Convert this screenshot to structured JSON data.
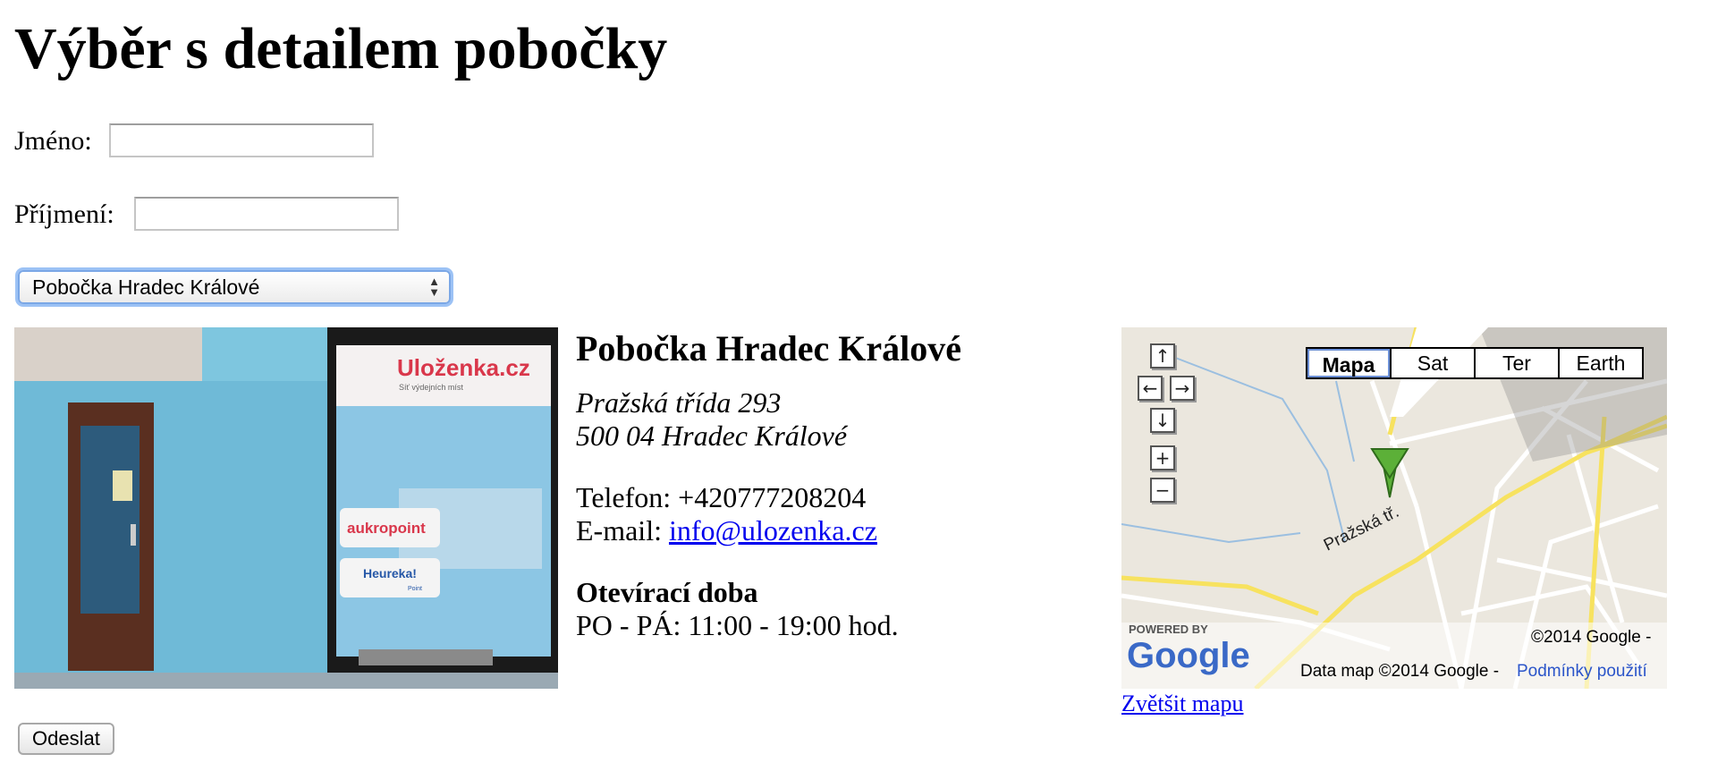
{
  "page": {
    "title": "Výběr s detailem pobočky"
  },
  "form": {
    "first_name_label": "Jméno:",
    "first_name_value": "",
    "last_name_label": "Příjmení:",
    "last_name_value": "",
    "branch_selected": "Pobočka Hradec Králové",
    "submit_label": "Odeslat"
  },
  "branch": {
    "name": "Pobočka Hradec Králové",
    "address_line1": "Pražská třída 293",
    "address_line2": "500 04 Hradec Králové",
    "phone_label": "Telefon:",
    "phone": "+420777208204",
    "email_label": "E-mail:",
    "email": "info@ulozenka.cz",
    "hours_heading": "Otevírací doba",
    "hours": "PO - PÁ: 11:00 - 19:00 hod.",
    "photo_signs": {
      "ulozenka": "Uloženka.cz",
      "ulozenka_sub": "Síť výdejních míst",
      "aukro": "aukropoint",
      "heureka": "Heureka!",
      "heureka_sub": "Point"
    }
  },
  "map": {
    "types": [
      "Mapa",
      "Sat",
      "Ter",
      "Earth"
    ],
    "street_label": "Pražská tř.",
    "powered_by": "POWERED BY",
    "google_logo": "Google",
    "copyright": "©2014 Google -",
    "data_credit": "Data map ©2014 Google -",
    "terms_link": "Podmínky použití",
    "enlarge_link": "Zvětšit mapu"
  },
  "colors": {
    "link": "#0000ee",
    "marker": "#5cb038",
    "focus": "#9cc2f5"
  }
}
